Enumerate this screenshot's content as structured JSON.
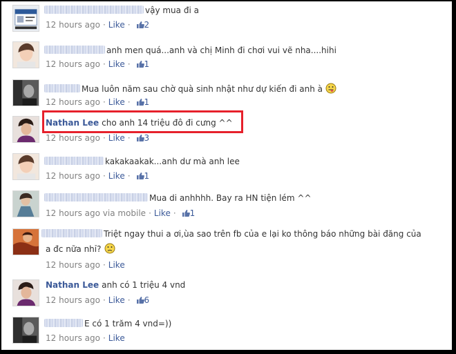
{
  "comments": [
    {
      "text": "vậy mua đi a",
      "time": "12 hours ago",
      "like": "Like",
      "likes": "2"
    },
    {
      "text": "anh men quá...anh và chị Minh đi chơi vui vẽ nha....hihi",
      "time": "12 hours ago",
      "like": "Like",
      "likes": "1"
    },
    {
      "text": "Mua luôn năm sau chờ quà sinh nhật như dự kiến đi anh à",
      "time": "12 hours ago",
      "like": "Like",
      "likes": "1"
    },
    {
      "name": "Nathan Lee",
      "text": "cho anh 14 triệu đô đi cưng ^^",
      "time": "12 hours ago",
      "like": "Like",
      "likes": "3"
    },
    {
      "text": "kakakaakak...anh dư mà anh lee",
      "time": "12 hours ago",
      "like": "Like",
      "likes": "1"
    },
    {
      "text": "Mua di anhhhh. Bay ra HN tiện lém ^^",
      "time": "12 hours ago via mobile",
      "like": "Like",
      "likes": "1"
    },
    {
      "text": "Triệt ngay thui a ơi,ùa sao trên fb của e lại ko thông báo những bài đăng của",
      "text2": "a đc nữa nhỉ?",
      "time": "12 hours ago",
      "like": "Like"
    },
    {
      "name": "Nathan Lee",
      "text": "anh có 1 triệu 4 vnd",
      "time": "12 hours ago",
      "like": "Like",
      "likes": "6"
    },
    {
      "text": "E có 1 trăm 4 vnd=))",
      "time": "12 hours ago",
      "like": "Like"
    }
  ],
  "colors": {
    "link": "#3b5998",
    "meta": "#808080",
    "highlight": "#e6202b"
  }
}
